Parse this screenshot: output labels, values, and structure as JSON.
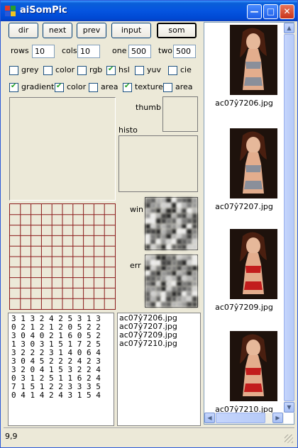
{
  "window": {
    "title": "aiSomPic"
  },
  "toolbar": {
    "buttons": [
      {
        "label": "dir"
      },
      {
        "label": "next"
      },
      {
        "label": "prev"
      },
      {
        "label": "input"
      },
      {
        "label": "som",
        "active": true
      }
    ]
  },
  "params": {
    "rows_label": "rows",
    "rows_value": "10",
    "cols_label": "cols",
    "cols_value": "10",
    "one_label": "one",
    "one_value": "500",
    "two_label": "two",
    "two_value": "500"
  },
  "options_row1": [
    {
      "label": "grey",
      "checked": false
    },
    {
      "label": "color",
      "checked": false
    },
    {
      "label": "rgb",
      "checked": false
    },
    {
      "label": "hsl",
      "checked": true
    },
    {
      "label": "yuv",
      "checked": false
    },
    {
      "label": "cie",
      "checked": false
    }
  ],
  "options_row2": [
    {
      "label": "gradient",
      "checked": true
    },
    {
      "label": "color",
      "checked": true
    },
    {
      "label": "area",
      "checked": false
    },
    {
      "label": "texture",
      "checked": true
    },
    {
      "label": "area",
      "checked": false
    }
  ],
  "views": {
    "thumb_label": "thumb",
    "histo_label": "histo",
    "win_label": "win",
    "err_label": "err"
  },
  "matrix": [
    "3 1 3 2 4 2 5 3 1 3",
    "0 2 1 2 1 2 0 5 2 2",
    "3 0 4 0 2 1 6 0 5 2",
    "1 3 0 3 1 5 1 7 2 5",
    "3 2 2 2 3 1 4 0 6 4",
    "3 0 4 5 2 2 2 4 2 3",
    "3 2 0 4 1 5 3 2 2 4",
    "0 3 1 2 5 1 1 6 2 4",
    "7 1 5 1 2 2 3 3 3 5",
    "0 4 1 4 2 4 3 1 5 4"
  ],
  "files": [
    "ac07ŷ7206.jpg",
    "ac07ŷ7207.jpg",
    "ac07ŷ7209.jpg",
    "ac07ŷ7210.jpg"
  ],
  "gallery": [
    {
      "caption": "ac07ŷ7206.jpg",
      "outfit": "#8a8f9a"
    },
    {
      "caption": "ac07ŷ7207.jpg",
      "outfit": "#8a8f9a"
    },
    {
      "caption": "ac07ŷ7209.jpg",
      "outfit": "#c21d1d"
    },
    {
      "caption": "ac07ŷ7210.jpg",
      "outfit": "#c21d1d"
    }
  ],
  "status": {
    "text": "9,9"
  },
  "colors": {
    "titlebar": "#0554e0",
    "grid_line": "#8a1b1b",
    "window_bg": "#ece9d8"
  }
}
